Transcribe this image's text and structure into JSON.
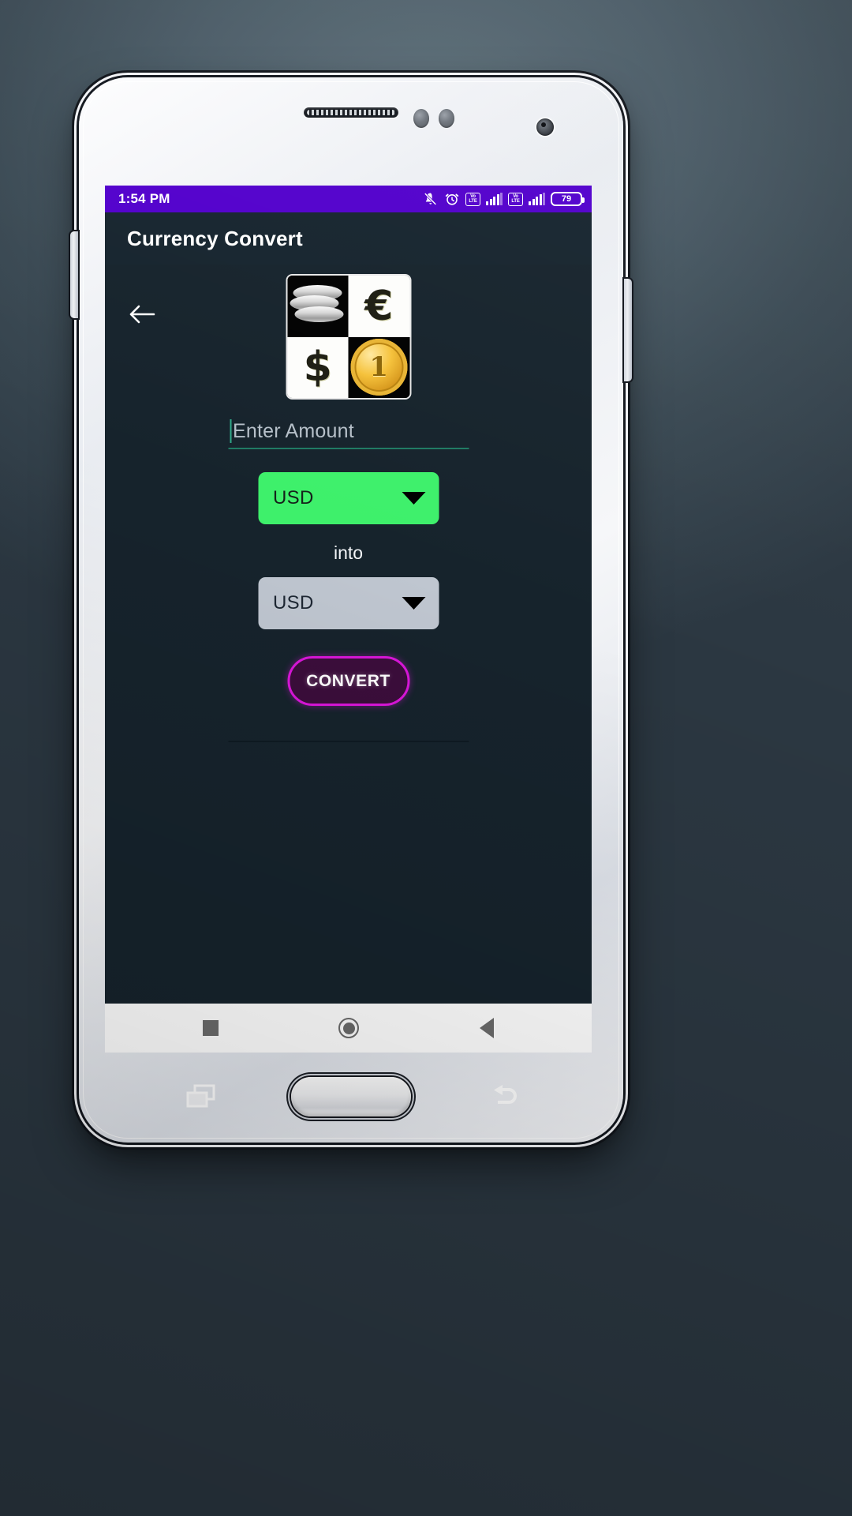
{
  "device": {
    "hardware": {
      "earpiece_name": "earpiece-speaker",
      "home_button_label": "",
      "recents_button_label": "",
      "back_button_label": ""
    }
  },
  "status_bar": {
    "time": "1:54 PM",
    "background_color": "#5200cc",
    "battery_level": "79",
    "icons": [
      "notifications-off-icon",
      "alarm-clock-icon",
      "volte-icon",
      "signal-bars-icon",
      "volte-icon",
      "signal-bars-icon",
      "battery-icon"
    ],
    "volte_top_text": "Vo",
    "volte_bottom_text": "LTE"
  },
  "app_bar": {
    "title": "Currency Convert",
    "background_color": "#16242e",
    "title_color": "#ffffff"
  },
  "content": {
    "background_color": "#16232c",
    "back_arrow_name": "back-arrow-icon",
    "hero_image": {
      "name": "currency-collage-image",
      "tiles": [
        {
          "position": "top-left",
          "background": "black",
          "glyph": "coin-stack"
        },
        {
          "position": "top-right",
          "background": "white",
          "glyph": "€"
        },
        {
          "position": "bottom-left",
          "background": "white",
          "glyph": "$"
        },
        {
          "position": "bottom-right",
          "background": "black",
          "glyph": "1"
        }
      ]
    },
    "amount_input": {
      "placeholder": "Enter Amount",
      "value": "",
      "underline_color": "#1f7a63",
      "caret_color": "#2fa98a"
    },
    "from_currency": {
      "selected": "USD",
      "background_color": "#3ef06b"
    },
    "into_label": "into",
    "to_currency": {
      "selected": "USD",
      "background_color": "#bfc6d0"
    },
    "convert_button": {
      "label": "CONVERT",
      "border_color": "#d916d9",
      "fill_color": "#3b0d3b",
      "text_color": "#ffffff"
    },
    "result_text": ""
  },
  "nav_bar": {
    "background_color": "#ffffff",
    "buttons": [
      "recents-button",
      "home-button",
      "back-button"
    ]
  }
}
